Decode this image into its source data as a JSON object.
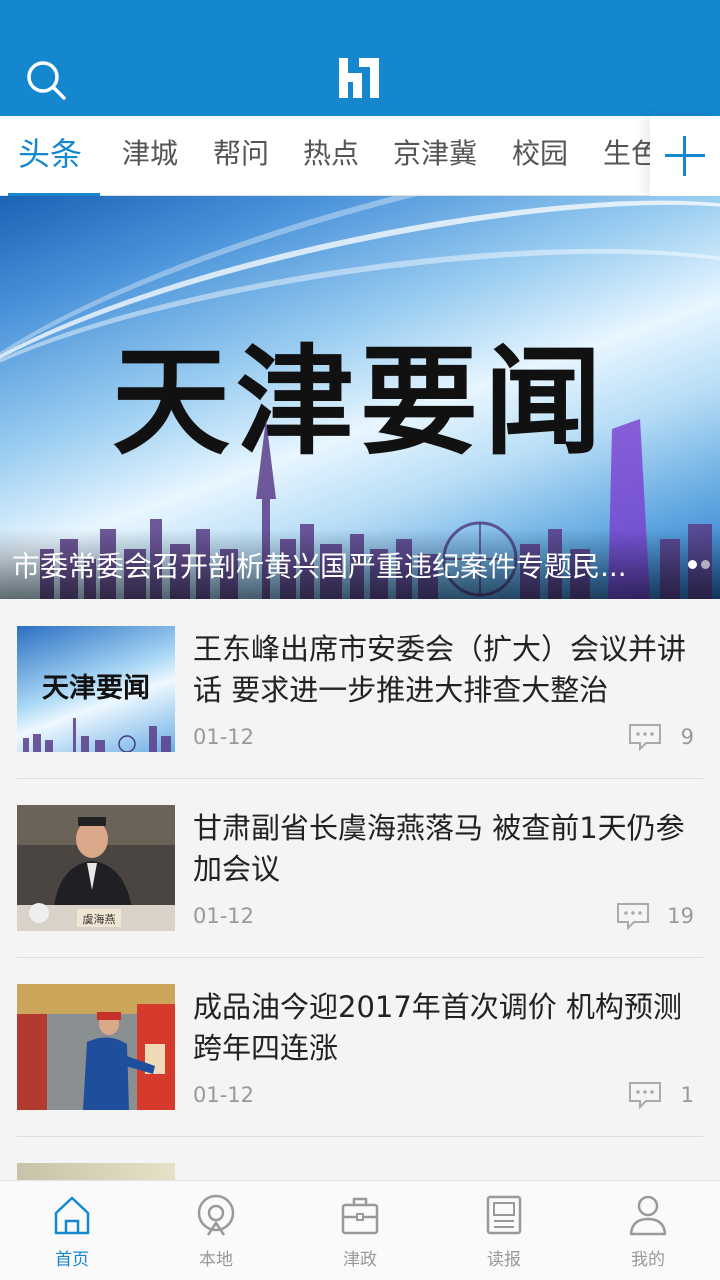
{
  "header": {
    "search_icon": "search-icon",
    "logo_icon": "app-logo-icon",
    "colors": {
      "brand": "#1587cf"
    }
  },
  "tabs": [
    {
      "label": "头条",
      "active": true
    },
    {
      "label": "津城"
    },
    {
      "label": "帮问"
    },
    {
      "label": "热点"
    },
    {
      "label": "京津冀"
    },
    {
      "label": "校园"
    },
    {
      "label": "生色"
    }
  ],
  "banner": {
    "image_text": "天津要闻",
    "caption": "市委常委会召开剖析黄兴国严重违纪案件专题民..."
  },
  "articles": [
    {
      "thumb_text": "天津要闻",
      "title": "王东峰出席市安委会（扩大）会议并讲话 要求进一步推进大排查大整治",
      "date": "01-12",
      "comments": "9"
    },
    {
      "thumb_text": "虞海燕",
      "title": "甘肃副省长虞海燕落马 被查前1天仍参加会议",
      "date": "01-12",
      "comments": "19"
    },
    {
      "title": "成品油今迎2017年首次调价 机构预测跨年四连涨",
      "date": "01-12",
      "comments": "1"
    }
  ],
  "bottom_nav": [
    {
      "label": "首页",
      "icon": "home-icon",
      "active": true
    },
    {
      "label": "本地",
      "icon": "location-icon"
    },
    {
      "label": "津政",
      "icon": "briefcase-icon"
    },
    {
      "label": "读报",
      "icon": "newspaper-icon"
    },
    {
      "label": "我的",
      "icon": "user-icon"
    }
  ]
}
